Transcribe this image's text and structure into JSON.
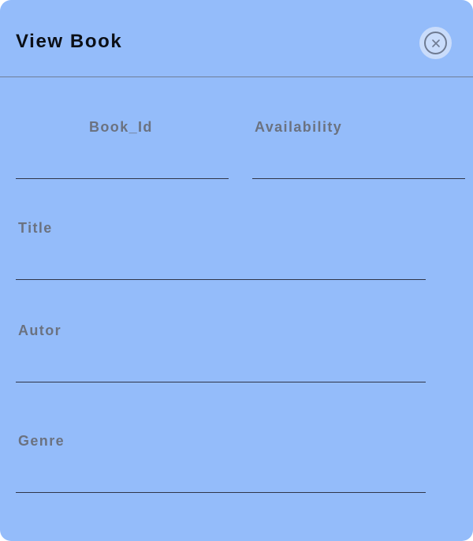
{
  "dialog": {
    "title": "View Book",
    "close_icon": "close-icon"
  },
  "fields": {
    "book_id": {
      "label": "Book_Id",
      "value": ""
    },
    "availability": {
      "label": "Availability",
      "value": ""
    },
    "title": {
      "label": "Title",
      "value": ""
    },
    "autor": {
      "label": "Autor",
      "value": ""
    },
    "genre": {
      "label": "Genre",
      "value": ""
    }
  },
  "colors": {
    "dialog_background": "#94bcfa",
    "title_text": "#0b0f16",
    "label_text": "#6b7280",
    "field_underline": "#2f3548",
    "divider": "#6f7f98",
    "close_button_background": "#c9dcfb"
  }
}
